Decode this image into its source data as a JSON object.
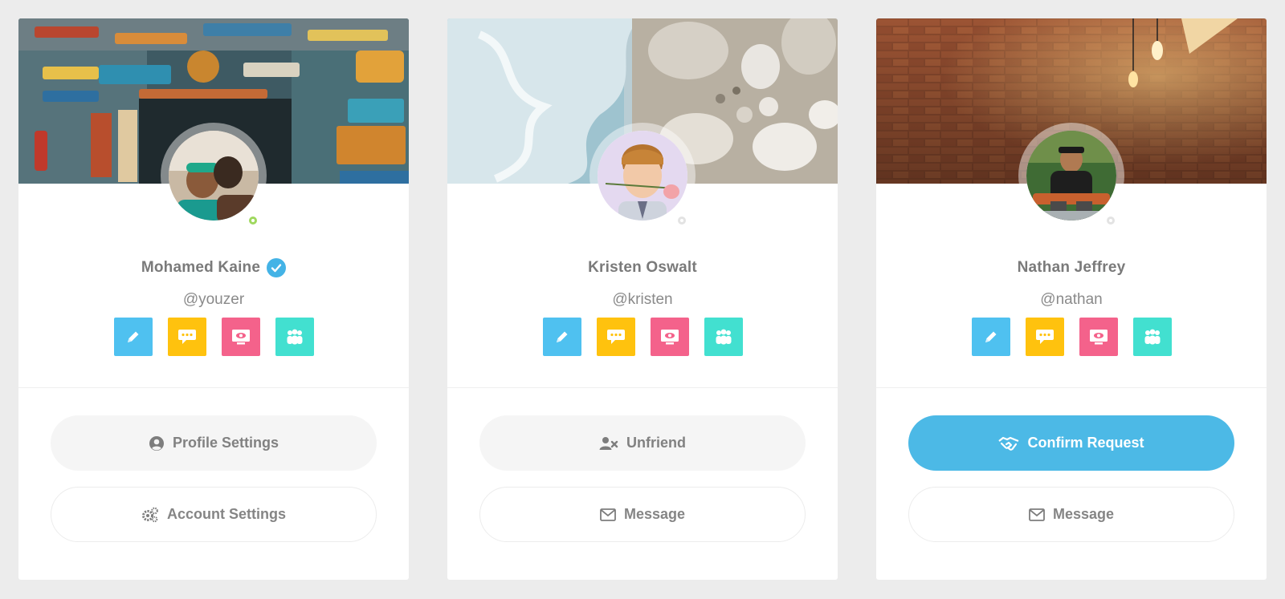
{
  "cards": [
    {
      "name": "Mohamed Kaine",
      "handle": "@youzer",
      "verified": true,
      "status": "online",
      "icons": [
        "pencil-icon",
        "chat-icon",
        "monitor-eye-icon",
        "group-icon"
      ],
      "actions": [
        {
          "label": "Profile Settings",
          "icon": "user-circle-icon",
          "style": "grey"
        },
        {
          "label": "Account Settings",
          "icon": "gears-icon",
          "style": "outline"
        }
      ]
    },
    {
      "name": "Kristen Oswalt",
      "handle": "@kristen",
      "verified": false,
      "status": "offline",
      "icons": [
        "pencil-icon",
        "chat-icon",
        "monitor-eye-icon",
        "group-icon"
      ],
      "actions": [
        {
          "label": "Unfriend",
          "icon": "user-times-icon",
          "style": "grey"
        },
        {
          "label": "Message",
          "icon": "envelope-icon",
          "style": "outline"
        }
      ]
    },
    {
      "name": "Nathan Jeffrey",
      "handle": "@nathan",
      "verified": false,
      "status": "offline",
      "icons": [
        "pencil-icon",
        "chat-icon",
        "monitor-eye-icon",
        "group-icon"
      ],
      "actions": [
        {
          "label": "Confirm Request",
          "icon": "handshake-icon",
          "style": "primary"
        },
        {
          "label": "Message",
          "icon": "envelope-icon",
          "style": "outline"
        }
      ]
    }
  ],
  "colors": {
    "background": "#ececec",
    "card": "#ffffff",
    "icon_blue": "#4fc1f0",
    "icon_yellow": "#ffc20e",
    "icon_pink": "#f4628b",
    "icon_teal": "#42e0d0",
    "primary": "#4cb9e6",
    "online": "#9fd85e",
    "verified": "#44b3e6"
  }
}
